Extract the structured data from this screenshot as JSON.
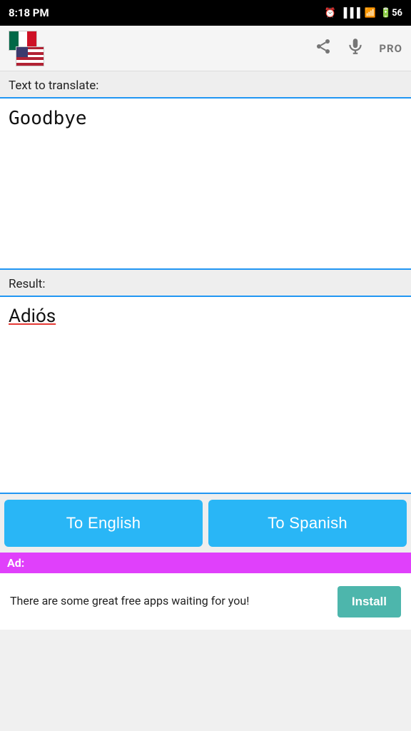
{
  "status_bar": {
    "time": "8:18 PM",
    "battery": "56"
  },
  "app_bar": {
    "pro_label": "PRO"
  },
  "main": {
    "source_label": "Text to translate:",
    "source_text": "Goodbye",
    "result_label": "Result:",
    "result_text": "Adiós",
    "btn_to_english": "To English",
    "btn_to_spanish": "To Spanish"
  },
  "ad": {
    "label": "Ad:",
    "message": "There are some great free apps waiting for you!",
    "install_btn": "Install"
  },
  "icons": {
    "share": "share-icon",
    "mic": "microphone-icon"
  }
}
